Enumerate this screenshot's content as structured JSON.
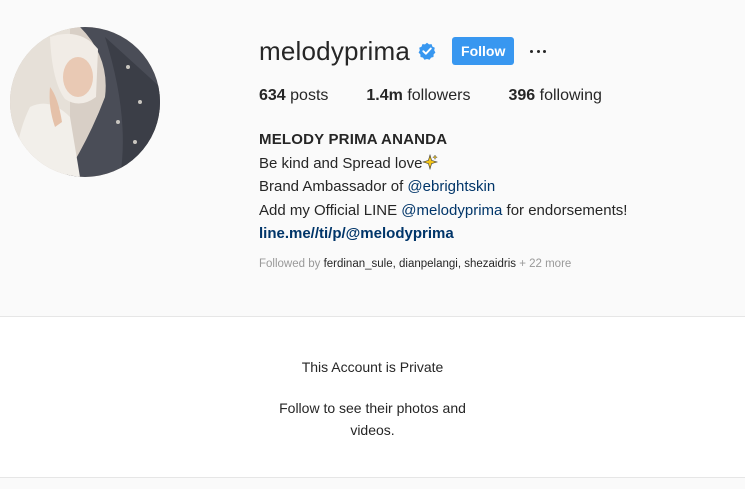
{
  "profile": {
    "username": "melodyprima",
    "follow_label": "Follow",
    "stats": {
      "posts_count": "634",
      "posts_label": "posts",
      "followers_count": "1.4m",
      "followers_label": "followers",
      "following_count": "396",
      "following_label": "following"
    },
    "bio": {
      "full_name": "MELODY PRIMA ANANDA",
      "line1": "Be kind and Spread love",
      "line2_prefix": "Brand Ambassador of ",
      "line2_mention": "@ebrightskin",
      "line3_prefix": "Add my Official LINE ",
      "line3_mention": "@melodyprima",
      "line3_suffix": " for endorsements!",
      "website": "line.me//ti/p/@melodyprima"
    },
    "followed_by": {
      "prefix": "Followed by ",
      "users": "ferdinan_sule, dianpelangi, shezaidris",
      "more": " + 22 more"
    }
  },
  "private": {
    "title": "This Account is Private",
    "message_line1": "Follow to see their photos and",
    "message_line2": "videos."
  },
  "colors": {
    "accent": "#3897f0",
    "link": "#003569",
    "muted": "#999999"
  }
}
